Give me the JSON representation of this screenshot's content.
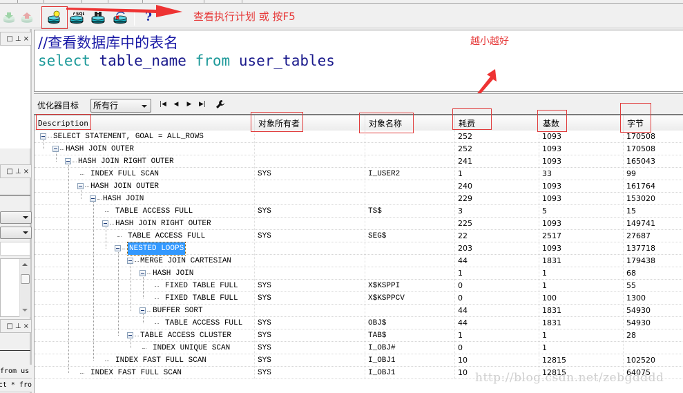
{
  "toolbar": {
    "buttons": [
      {
        "name": "download-icon",
        "label": "",
        "enabled": false
      },
      {
        "name": "upload-icon",
        "label": "",
        "enabled": false
      },
      {
        "name": "explain-plan-icon",
        "label": "",
        "enabled": true
      },
      {
        "name": "autotrace-sql-icon",
        "label": "SQL",
        "enabled": true
      },
      {
        "name": "find-db-icon",
        "label": "",
        "enabled": true
      },
      {
        "name": "cancel-refresh-icon",
        "label": "",
        "enabled": true
      },
      {
        "name": "help-icon",
        "label": "?",
        "enabled": true
      }
    ]
  },
  "annotations": {
    "toolbar_hint": "查看执行计划  或 按F5",
    "cost_hint": "越小越好",
    "color": "#e63a3a"
  },
  "left_panel": {
    "code_line_1": "from us",
    "code_line_2": "ct * fro"
  },
  "editor": {
    "comment": "//查看数据库中的表名",
    "sql_keyword_select": "select",
    "sql_ident_table_name": "table_name",
    "sql_keyword_from": "from",
    "sql_ident_user_tables": "user_tables"
  },
  "optimizer": {
    "label": "优化器目标",
    "selected": "所有行",
    "nav_first": "|◀",
    "nav_prev": "◀",
    "nav_next": "▶",
    "nav_last": "▶|"
  },
  "grid": {
    "columns": [
      "Description",
      "对象所有者",
      "对象名称",
      "耗费",
      "基数",
      "字节"
    ],
    "rows": [
      {
        "depth": 0,
        "expand": true,
        "desc": "SELECT STATEMENT, GOAL = ALL_ROWS",
        "owner": "",
        "object": "",
        "cost": "252",
        "card": "1093",
        "bytes": "170508"
      },
      {
        "depth": 1,
        "expand": true,
        "desc": "HASH JOIN OUTER",
        "owner": "",
        "object": "",
        "cost": "252",
        "card": "1093",
        "bytes": "170508"
      },
      {
        "depth": 2,
        "expand": true,
        "desc": "HASH JOIN RIGHT OUTER",
        "owner": "",
        "object": "",
        "cost": "241",
        "card": "1093",
        "bytes": "165043"
      },
      {
        "depth": 3,
        "expand": false,
        "desc": "INDEX FULL SCAN",
        "owner": "SYS",
        "object": "I_USER2",
        "cost": "1",
        "card": "33",
        "bytes": "99"
      },
      {
        "depth": 3,
        "expand": true,
        "desc": "HASH JOIN OUTER",
        "owner": "",
        "object": "",
        "cost": "240",
        "card": "1093",
        "bytes": "161764"
      },
      {
        "depth": 4,
        "expand": true,
        "desc": "HASH JOIN",
        "owner": "",
        "object": "",
        "cost": "229",
        "card": "1093",
        "bytes": "153020"
      },
      {
        "depth": 5,
        "expand": false,
        "desc": "TABLE ACCESS FULL",
        "owner": "SYS",
        "object": "TS$",
        "cost": "3",
        "card": "5",
        "bytes": "15"
      },
      {
        "depth": 5,
        "expand": true,
        "desc": "HASH JOIN RIGHT OUTER",
        "owner": "",
        "object": "",
        "cost": "225",
        "card": "1093",
        "bytes": "149741"
      },
      {
        "depth": 6,
        "expand": false,
        "desc": "TABLE ACCESS FULL",
        "owner": "SYS",
        "object": "SEG$",
        "cost": "22",
        "card": "2517",
        "bytes": "27687"
      },
      {
        "depth": 6,
        "expand": true,
        "desc": "NESTED LOOPS",
        "owner": "",
        "object": "",
        "cost": "203",
        "card": "1093",
        "bytes": "137718",
        "selected": true
      },
      {
        "depth": 7,
        "expand": true,
        "desc": "MERGE JOIN CARTESIAN",
        "owner": "",
        "object": "",
        "cost": "44",
        "card": "1831",
        "bytes": "179438"
      },
      {
        "depth": 8,
        "expand": true,
        "desc": "HASH JOIN",
        "owner": "",
        "object": "",
        "cost": "1",
        "card": "1",
        "bytes": "68"
      },
      {
        "depth": 9,
        "expand": false,
        "desc": "FIXED TABLE FULL",
        "owner": "SYS",
        "object": "X$KSPPI",
        "cost": "0",
        "card": "1",
        "bytes": "55"
      },
      {
        "depth": 9,
        "expand": false,
        "desc": "FIXED TABLE FULL",
        "owner": "SYS",
        "object": "X$KSPPCV",
        "cost": "0",
        "card": "100",
        "bytes": "1300"
      },
      {
        "depth": 8,
        "expand": true,
        "desc": "BUFFER SORT",
        "owner": "",
        "object": "",
        "cost": "44",
        "card": "1831",
        "bytes": "54930"
      },
      {
        "depth": 9,
        "expand": false,
        "desc": "TABLE ACCESS FULL",
        "owner": "SYS",
        "object": "OBJ$",
        "cost": "44",
        "card": "1831",
        "bytes": "54930"
      },
      {
        "depth": 7,
        "expand": true,
        "desc": "TABLE ACCESS CLUSTER",
        "owner": "SYS",
        "object": "TAB$",
        "cost": "1",
        "card": "1",
        "bytes": "28"
      },
      {
        "depth": 8,
        "expand": false,
        "desc": "INDEX UNIQUE SCAN",
        "owner": "SYS",
        "object": "I_OBJ#",
        "cost": "0",
        "card": "1",
        "bytes": ""
      },
      {
        "depth": 5,
        "expand": false,
        "desc": "INDEX FAST FULL SCAN",
        "owner": "SYS",
        "object": "I_OBJ1",
        "cost": "10",
        "card": "12815",
        "bytes": "102520"
      },
      {
        "depth": 3,
        "expand": false,
        "desc": "INDEX FAST FULL SCAN",
        "owner": "SYS",
        "object": "I_OBJ1",
        "cost": "10",
        "card": "12815",
        "bytes": "64075"
      }
    ]
  },
  "watermark": "http://blog.csdn.net/zebgdddd"
}
